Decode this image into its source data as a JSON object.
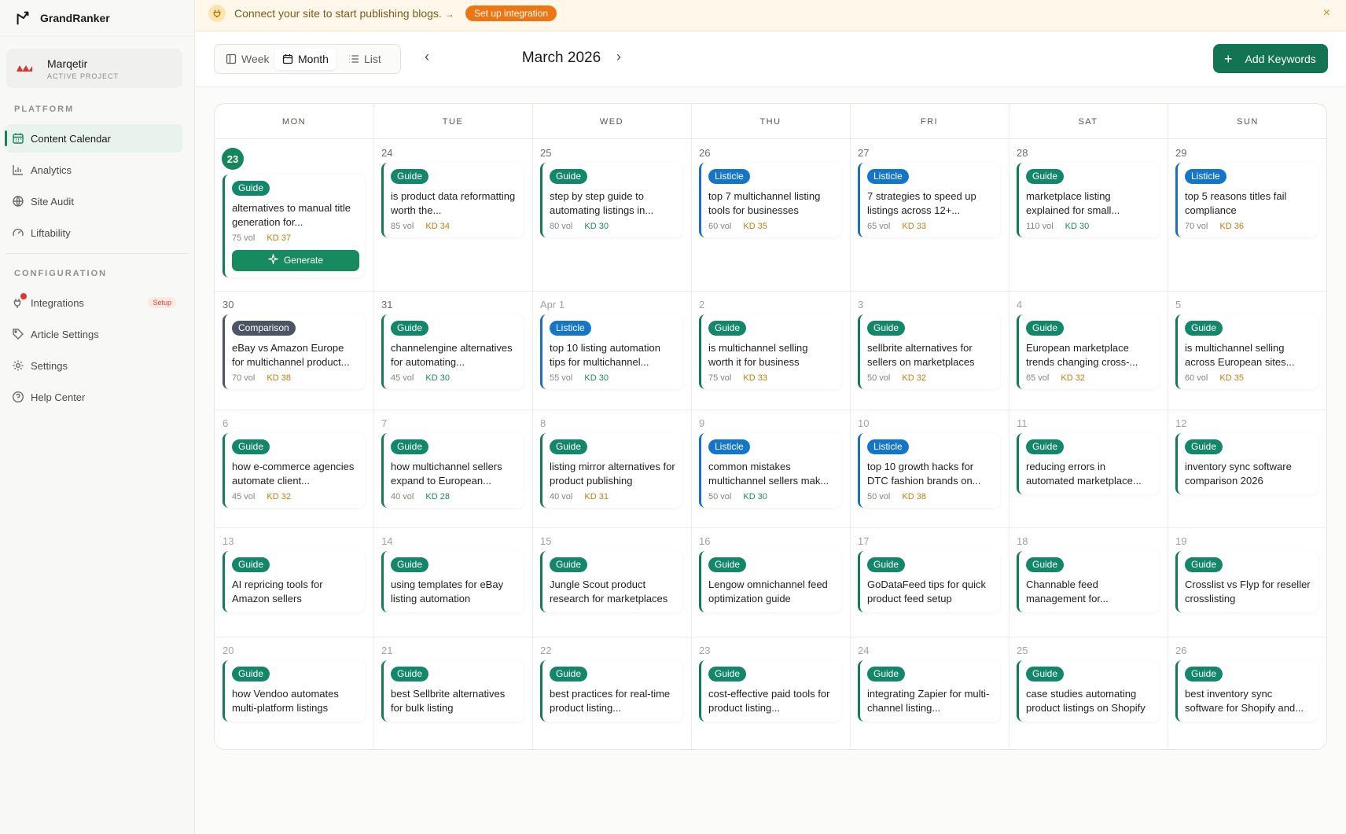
{
  "app": {
    "name": "GrandRanker"
  },
  "project": {
    "name": "Marqetir",
    "subtitle": "ACTIVE PROJECT"
  },
  "sidebar": {
    "platform_label": "PLATFORM",
    "config_label": "CONFIGURATION",
    "platform_items": [
      {
        "label": "Content Calendar",
        "icon": "calendar-icon",
        "active": true
      },
      {
        "label": "Analytics",
        "icon": "bar-chart-icon"
      },
      {
        "label": "Site Audit",
        "icon": "globe-icon"
      },
      {
        "label": "Liftability",
        "icon": "gauge-icon"
      }
    ],
    "config_items": [
      {
        "label": "Integrations",
        "icon": "plug-icon",
        "badge": "Setup"
      },
      {
        "label": "Article Settings",
        "icon": "tag-icon"
      },
      {
        "label": "Settings",
        "icon": "gear-icon"
      },
      {
        "label": "Help Center",
        "icon": "help-circle-icon"
      }
    ]
  },
  "banner": {
    "text": "Connect your site to start publishing blogs.",
    "arrow": "→",
    "button": "Set up integration",
    "close": "×"
  },
  "toolbar": {
    "views": [
      "Week",
      "Month",
      "List"
    ],
    "active_view": "Month",
    "month": "March 2026",
    "prev": "‹",
    "next": "›",
    "add_button": "Add Keywords"
  },
  "calendar": {
    "weekdays": [
      "MON",
      "TUE",
      "WED",
      "THU",
      "FRI",
      "SAT",
      "SUN"
    ],
    "weeks": [
      [
        {
          "day": "23",
          "today": true,
          "type": "Guide",
          "title": "alternatives to manual title generation for...",
          "vol": "75 vol",
          "kd": "KD 37",
          "generate": "Generate"
        },
        {
          "day": "24",
          "type": "Guide",
          "title": "is product data reformatting worth the...",
          "vol": "85 vol",
          "kd": "KD 34"
        },
        {
          "day": "25",
          "type": "Guide",
          "title": "step by step guide to automating listings in...",
          "vol": "80 vol",
          "kd": "KD 30"
        },
        {
          "day": "26",
          "type": "Listicle",
          "title": "top 7 multichannel listing tools for businesses",
          "vol": "60 vol",
          "kd": "KD 35"
        },
        {
          "day": "27",
          "type": "Listicle",
          "title": "7 strategies to speed up listings across 12+...",
          "vol": "65 vol",
          "kd": "KD 33"
        },
        {
          "day": "28",
          "type": "Guide",
          "title": "marketplace listing explained for small...",
          "vol": "110 vol",
          "kd": "KD 30"
        },
        {
          "day": "29",
          "type": "Listicle",
          "title": "top 5 reasons titles fail compliance",
          "vol": "70 vol",
          "kd": "KD 36"
        }
      ],
      [
        {
          "day": "30",
          "type": "Comparison",
          "title": "eBay vs Amazon Europe for multichannel product...",
          "vol": "70 vol",
          "kd": "KD 38"
        },
        {
          "day": "31",
          "type": "Guide",
          "title": "channelengine alternatives for automating...",
          "vol": "45 vol",
          "kd": "KD 30"
        },
        {
          "day": "Apr 1",
          "faded": true,
          "type": "Listicle",
          "title": "top 10 listing automation tips for multichannel...",
          "vol": "55 vol",
          "kd": "KD 30"
        },
        {
          "day": "2",
          "faded": true,
          "type": "Guide",
          "title": "is multichannel selling worth it for business",
          "vol": "75 vol",
          "kd": "KD 33"
        },
        {
          "day": "3",
          "faded": true,
          "type": "Guide",
          "title": "sellbrite alternatives for sellers on marketplaces",
          "vol": "50 vol",
          "kd": "KD 32"
        },
        {
          "day": "4",
          "faded": true,
          "type": "Guide",
          "title": "European marketplace trends changing cross-...",
          "vol": "65 vol",
          "kd": "KD 32"
        },
        {
          "day": "5",
          "faded": true,
          "type": "Guide",
          "title": "is multichannel selling across European sites...",
          "vol": "60 vol",
          "kd": "KD 35"
        }
      ],
      [
        {
          "day": "6",
          "faded": true,
          "type": "Guide",
          "title": "how e-commerce agencies automate client...",
          "vol": "45 vol",
          "kd": "KD 32"
        },
        {
          "day": "7",
          "faded": true,
          "type": "Guide",
          "title": "how multichannel sellers expand to European...",
          "vol": "40 vol",
          "kd": "KD 28"
        },
        {
          "day": "8",
          "faded": true,
          "type": "Guide",
          "title": "listing mirror alternatives for product publishing",
          "vol": "40 vol",
          "kd": "KD 31"
        },
        {
          "day": "9",
          "faded": true,
          "type": "Listicle",
          "title": "common mistakes multichannel sellers mak...",
          "vol": "50 vol",
          "kd": "KD 30"
        },
        {
          "day": "10",
          "faded": true,
          "type": "Listicle",
          "title": "top 10 growth hacks for DTC fashion brands on...",
          "vol": "50 vol",
          "kd": "KD 38"
        },
        {
          "day": "11",
          "faded": true,
          "type": "Guide",
          "title": "reducing errors in automated marketplace..."
        },
        {
          "day": "12",
          "faded": true,
          "type": "Guide",
          "title": "inventory sync software comparison 2026"
        }
      ],
      [
        {
          "day": "13",
          "faded": true,
          "type": "Guide",
          "title": "AI repricing tools for Amazon sellers"
        },
        {
          "day": "14",
          "faded": true,
          "type": "Guide",
          "title": "using templates for eBay listing automation"
        },
        {
          "day": "15",
          "faded": true,
          "type": "Guide",
          "title": "Jungle Scout product research for marketplaces"
        },
        {
          "day": "16",
          "faded": true,
          "type": "Guide",
          "title": "Lengow omnichannel feed optimization guide"
        },
        {
          "day": "17",
          "faded": true,
          "type": "Guide",
          "title": "GoDataFeed tips for quick product feed setup"
        },
        {
          "day": "18",
          "faded": true,
          "type": "Guide",
          "title": "Channable feed management for..."
        },
        {
          "day": "19",
          "faded": true,
          "type": "Guide",
          "title": "Crosslist vs Flyp for reseller crosslisting"
        }
      ],
      [
        {
          "day": "20",
          "faded": true,
          "type": "Guide",
          "title": "how Vendoo automates multi-platform listings"
        },
        {
          "day": "21",
          "faded": true,
          "type": "Guide",
          "title": "best Sellbrite alternatives for bulk listing"
        },
        {
          "day": "22",
          "faded": true,
          "type": "Guide",
          "title": "best practices for real-time product listing..."
        },
        {
          "day": "23",
          "faded": true,
          "type": "Guide",
          "title": "cost-effective paid tools for product listing..."
        },
        {
          "day": "24",
          "faded": true,
          "type": "Guide",
          "title": "integrating Zapier for multi-channel listing..."
        },
        {
          "day": "25",
          "faded": true,
          "type": "Guide",
          "title": "case studies automating product listings on Shopify"
        },
        {
          "day": "26",
          "faded": true,
          "type": "Guide",
          "title": "best inventory sync software for Shopify and..."
        }
      ]
    ]
  },
  "colors": {
    "primary_green": "#127452",
    "guide_tag": "#14866a",
    "listicle_tag": "#1576c8",
    "comparison_tag": "#4b5563",
    "kd_hard": "#c27d12",
    "kd_easy": "#1c8a60",
    "banner_button": "#ee7612"
  }
}
